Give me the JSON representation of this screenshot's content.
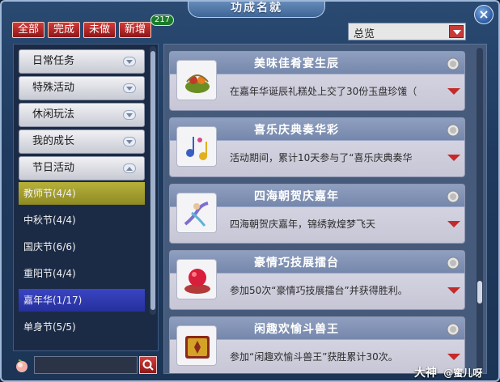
{
  "window": {
    "title": "功成名就",
    "close_label": "×"
  },
  "filters": {
    "tabs": [
      "全部",
      "完成",
      "未做",
      "新增"
    ],
    "new_count": "217"
  },
  "view": {
    "selected": "总览"
  },
  "sidebar": {
    "categories": [
      {
        "label": "日常任务"
      },
      {
        "label": "特殊活动"
      },
      {
        "label": "休闲玩法"
      },
      {
        "label": "我的成长"
      },
      {
        "label": "节日活动"
      }
    ],
    "festivals": [
      {
        "label": "教师节(4/4)"
      },
      {
        "label": "中秋节(4/4)"
      },
      {
        "label": "国庆节(6/6)"
      },
      {
        "label": "重阳节(4/4)"
      },
      {
        "label": "嘉年华(1/17)"
      },
      {
        "label": "单身节(5/5)"
      }
    ]
  },
  "search": {
    "placeholder": ""
  },
  "achievements": [
    {
      "title": "美味佳肴宴生辰",
      "desc": "在嘉年华诞辰礼糕处上交了30份玉盘珍馐（",
      "icon": "food-basket-icon"
    },
    {
      "title": "喜乐庆典奏华彩",
      "desc": "活动期间，累计10天参与了“喜乐庆典奏华",
      "icon": "music-notes-icon"
    },
    {
      "title": "四海朝贺庆嘉年",
      "desc": "四海朝贺庆嘉年，锦绣敦煌梦飞天",
      "icon": "flying-apsara-icon"
    },
    {
      "title": "豪情巧技展擂台",
      "desc": "参加50次“豪情巧技展擂台”并获得胜利。",
      "icon": "red-silk-ball-icon"
    },
    {
      "title": "闲趣欢愉斗兽王",
      "desc": "参加“闲趣欢愉斗兽王”获胜累计30次。",
      "icon": "golden-book-icon"
    }
  ],
  "watermark": {
    "brand": "大神",
    "user": "@蜜儿呀"
  }
}
